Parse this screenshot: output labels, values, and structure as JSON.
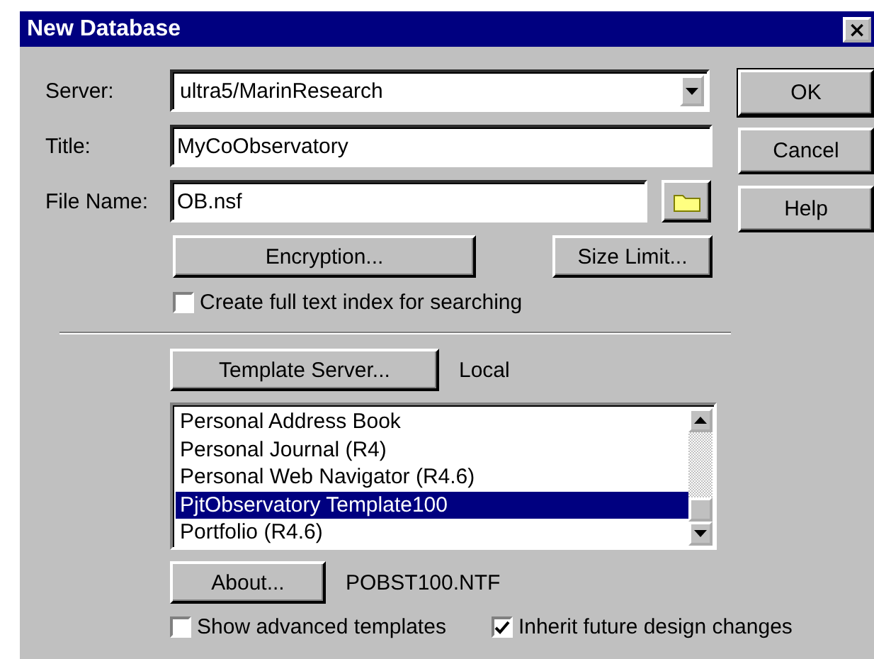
{
  "window": {
    "title": "New Database",
    "close": "×"
  },
  "server": {
    "label": "Server:",
    "value": "ultra5/MarinResearch"
  },
  "title_field": {
    "label": "Title:",
    "value": "MyCoObservatory"
  },
  "file_name": {
    "label": "File Name:",
    "value": "OB.nsf"
  },
  "side_buttons": [
    "OK",
    "Cancel",
    "Help"
  ],
  "encryption_button": "Encryption...",
  "size_limit_button": "Size Limit...",
  "full_text_index": {
    "label": "Create full text index for searching",
    "checked": false
  },
  "template_server": {
    "button": "Template Server...",
    "value": "Local"
  },
  "templates": [
    {
      "label": "Personal Address Book",
      "selected": false
    },
    {
      "label": "Personal Journal (R4)",
      "selected": false
    },
    {
      "label": "Personal Web Navigator (R4.6)",
      "selected": false
    },
    {
      "label": "PjtObservatory Template100",
      "selected": true
    },
    {
      "label": "Portfolio (R4.6)",
      "selected": false
    }
  ],
  "about": {
    "button": "About...",
    "file": "POBST100.NTF"
  },
  "bottom_checks": [
    {
      "label": "Show advanced templates",
      "checked": false
    },
    {
      "label": "Inherit future design changes",
      "checked": true
    }
  ]
}
